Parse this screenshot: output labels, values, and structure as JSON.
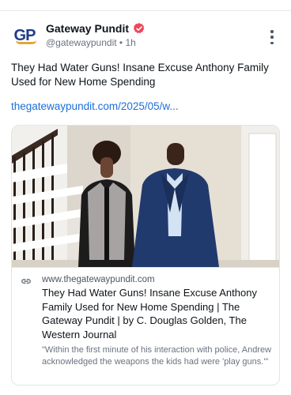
{
  "post": {
    "author_name": "Gateway Pundit",
    "avatar_initials": "GP",
    "handle": "@gatewaypundit",
    "separator": "•",
    "time": "1h",
    "text": "They Had Water Guns! Insane Excuse Anthony Family Used for New Home Spending",
    "link_text": "thegatewaypundit.com/2025/05/w..."
  },
  "card": {
    "domain": "www.thegatewaypundit.com",
    "title": "They Had Water Guns! Insane Excuse Anthony Family Used for New Home Spending | The Gateway Pundit | by C. Douglas Golden, The Western Journal",
    "description": "\"Within the first minute of his interaction with police, Andrew acknowledged the weapons the kids had were 'play guns.'\""
  },
  "colors": {
    "link": "#1d6fd6",
    "verified_badge": "#f0455a",
    "logo_blue": "#1f3c88",
    "logo_gold": "#e3a72f"
  },
  "icons": {
    "verified": "verified-badge-icon",
    "more": "more-vertical-icon",
    "link": "link-icon"
  }
}
